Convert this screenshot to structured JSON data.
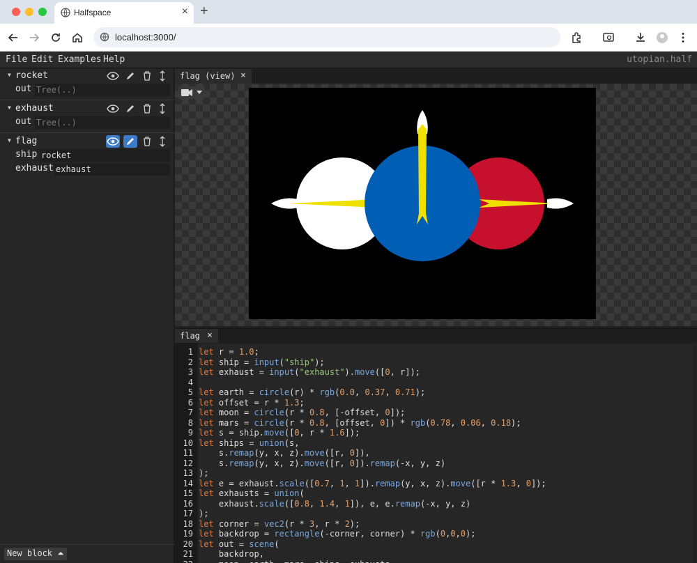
{
  "browser": {
    "tab_title": "Halfspace",
    "url": "localhost:3000/"
  },
  "menu": {
    "items": [
      "File",
      "Edit",
      "Examples",
      "Help"
    ],
    "filename": "utopian.half"
  },
  "sidebar": {
    "blocks": [
      {
        "name": "rocket",
        "rows": [
          {
            "label": "out",
            "value": "Tree(..)",
            "kind": "placeholder"
          }
        ],
        "view_active": false,
        "edit_active": false
      },
      {
        "name": "exhaust",
        "rows": [
          {
            "label": "out",
            "value": "Tree(..)",
            "kind": "placeholder"
          }
        ],
        "view_active": false,
        "edit_active": false
      },
      {
        "name": "flag",
        "rows": [
          {
            "label": "ship",
            "value": "rocket",
            "kind": "filled"
          },
          {
            "label": "exhaust",
            "value": "exhaust",
            "kind": "filled"
          }
        ],
        "view_active": true,
        "edit_active": true
      }
    ],
    "new_block_label": "New block ⏶"
  },
  "view_panel": {
    "tab_label": "flag (view)",
    "icon": "camera-icon",
    "scene_colors": {
      "backdrop": "#000000",
      "earth": "#005eb5",
      "moon": "#ffffff",
      "mars": "#c70f2e",
      "flame": "#f0e000"
    }
  },
  "editor_panel": {
    "tab_label": "flag",
    "lines": [
      [
        [
          "k",
          "let "
        ],
        [
          "i",
          "r = "
        ],
        [
          "n",
          "1.0"
        ],
        [
          "o",
          ";"
        ]
      ],
      [
        [
          "k",
          "let "
        ],
        [
          "i",
          "ship = "
        ],
        [
          "f",
          "input"
        ],
        [
          "o",
          "("
        ],
        [
          "s",
          "\"ship\""
        ],
        [
          "o",
          ");"
        ]
      ],
      [
        [
          "k",
          "let "
        ],
        [
          "i",
          "exhaust = "
        ],
        [
          "f",
          "input"
        ],
        [
          "o",
          "("
        ],
        [
          "s",
          "\"exhaust\""
        ],
        [
          "o",
          ")."
        ],
        [
          "f",
          "move"
        ],
        [
          "o",
          "(["
        ],
        [
          "n",
          "0"
        ],
        [
          "o",
          ", r]);"
        ]
      ],
      [],
      [
        [
          "k",
          "let "
        ],
        [
          "i",
          "earth = "
        ],
        [
          "f",
          "circle"
        ],
        [
          "o",
          "(r) * "
        ],
        [
          "f",
          "rgb"
        ],
        [
          "o",
          "("
        ],
        [
          "n",
          "0.0"
        ],
        [
          "o",
          ", "
        ],
        [
          "n",
          "0.37"
        ],
        [
          "o",
          ", "
        ],
        [
          "n",
          "0.71"
        ],
        [
          "o",
          ");"
        ]
      ],
      [
        [
          "k",
          "let "
        ],
        [
          "i",
          "offset = r * "
        ],
        [
          "n",
          "1.3"
        ],
        [
          "o",
          ";"
        ]
      ],
      [
        [
          "k",
          "let "
        ],
        [
          "i",
          "moon = "
        ],
        [
          "f",
          "circle"
        ],
        [
          "o",
          "(r * "
        ],
        [
          "n",
          "0.8"
        ],
        [
          "o",
          ", [-offset, "
        ],
        [
          "n",
          "0"
        ],
        [
          "o",
          "]);"
        ]
      ],
      [
        [
          "k",
          "let "
        ],
        [
          "i",
          "mars = "
        ],
        [
          "f",
          "circle"
        ],
        [
          "o",
          "(r * "
        ],
        [
          "n",
          "0.8"
        ],
        [
          "o",
          ", [offset, "
        ],
        [
          "n",
          "0"
        ],
        [
          "o",
          "]) * "
        ],
        [
          "f",
          "rgb"
        ],
        [
          "o",
          "("
        ],
        [
          "n",
          "0.78"
        ],
        [
          "o",
          ", "
        ],
        [
          "n",
          "0.06"
        ],
        [
          "o",
          ", "
        ],
        [
          "n",
          "0.18"
        ],
        [
          "o",
          ");"
        ]
      ],
      [
        [
          "k",
          "let "
        ],
        [
          "i",
          "s = ship."
        ],
        [
          "f",
          "move"
        ],
        [
          "o",
          "(["
        ],
        [
          "n",
          "0"
        ],
        [
          "o",
          ", r * "
        ],
        [
          "n",
          "1.6"
        ],
        [
          "o",
          "]);"
        ]
      ],
      [
        [
          "k",
          "let "
        ],
        [
          "i",
          "ships = "
        ],
        [
          "f",
          "union"
        ],
        [
          "o",
          "(s,"
        ]
      ],
      [
        [
          "o",
          "    s."
        ],
        [
          "f",
          "remap"
        ],
        [
          "o",
          "(y, x, z)."
        ],
        [
          "f",
          "move"
        ],
        [
          "o",
          "([r, "
        ],
        [
          "n",
          "0"
        ],
        [
          "o",
          "]),"
        ]
      ],
      [
        [
          "o",
          "    s."
        ],
        [
          "f",
          "remap"
        ],
        [
          "o",
          "(y, x, z)."
        ],
        [
          "f",
          "move"
        ],
        [
          "o",
          "([r, "
        ],
        [
          "n",
          "0"
        ],
        [
          "o",
          "])."
        ],
        [
          "f",
          "remap"
        ],
        [
          "o",
          "(-x, y, z)"
        ]
      ],
      [
        [
          "o",
          ");"
        ]
      ],
      [
        [
          "k",
          "let "
        ],
        [
          "i",
          "e = exhaust."
        ],
        [
          "f",
          "scale"
        ],
        [
          "o",
          "(["
        ],
        [
          "n",
          "0.7"
        ],
        [
          "o",
          ", "
        ],
        [
          "n",
          "1"
        ],
        [
          "o",
          ", "
        ],
        [
          "n",
          "1"
        ],
        [
          "o",
          "])."
        ],
        [
          "f",
          "remap"
        ],
        [
          "o",
          "(y, x, z)."
        ],
        [
          "f",
          "move"
        ],
        [
          "o",
          "([r * "
        ],
        [
          "n",
          "1.3"
        ],
        [
          "o",
          ", "
        ],
        [
          "n",
          "0"
        ],
        [
          "o",
          "]);"
        ]
      ],
      [
        [
          "k",
          "let "
        ],
        [
          "i",
          "exhausts = "
        ],
        [
          "f",
          "union"
        ],
        [
          "o",
          "("
        ]
      ],
      [
        [
          "o",
          "    exhaust."
        ],
        [
          "f",
          "scale"
        ],
        [
          "o",
          "(["
        ],
        [
          "n",
          "0.8"
        ],
        [
          "o",
          ", "
        ],
        [
          "n",
          "1.4"
        ],
        [
          "o",
          ", "
        ],
        [
          "n",
          "1"
        ],
        [
          "o",
          "]), e, e."
        ],
        [
          "f",
          "remap"
        ],
        [
          "o",
          "(-x, y, z)"
        ]
      ],
      [
        [
          "o",
          ");"
        ]
      ],
      [
        [
          "k",
          "let "
        ],
        [
          "i",
          "corner = "
        ],
        [
          "f",
          "vec2"
        ],
        [
          "o",
          "(r * "
        ],
        [
          "n",
          "3"
        ],
        [
          "o",
          ", r * "
        ],
        [
          "n",
          "2"
        ],
        [
          "o",
          ");"
        ]
      ],
      [
        [
          "k",
          "let "
        ],
        [
          "i",
          "backdrop = "
        ],
        [
          "f",
          "rectangle"
        ],
        [
          "o",
          "(-corner, corner) * "
        ],
        [
          "f",
          "rgb"
        ],
        [
          "o",
          "("
        ],
        [
          "n",
          "0"
        ],
        [
          "o",
          ","
        ],
        [
          "n",
          "0"
        ],
        [
          "o",
          ","
        ],
        [
          "n",
          "0"
        ],
        [
          "o",
          ");"
        ]
      ],
      [
        [
          "k",
          "let "
        ],
        [
          "i",
          "out = "
        ],
        [
          "f",
          "scene"
        ],
        [
          "o",
          "("
        ]
      ],
      [
        [
          "o",
          "    backdrop,"
        ]
      ],
      [
        [
          "o",
          "    moon, earth, mars, ships, exhausts"
        ]
      ]
    ]
  }
}
